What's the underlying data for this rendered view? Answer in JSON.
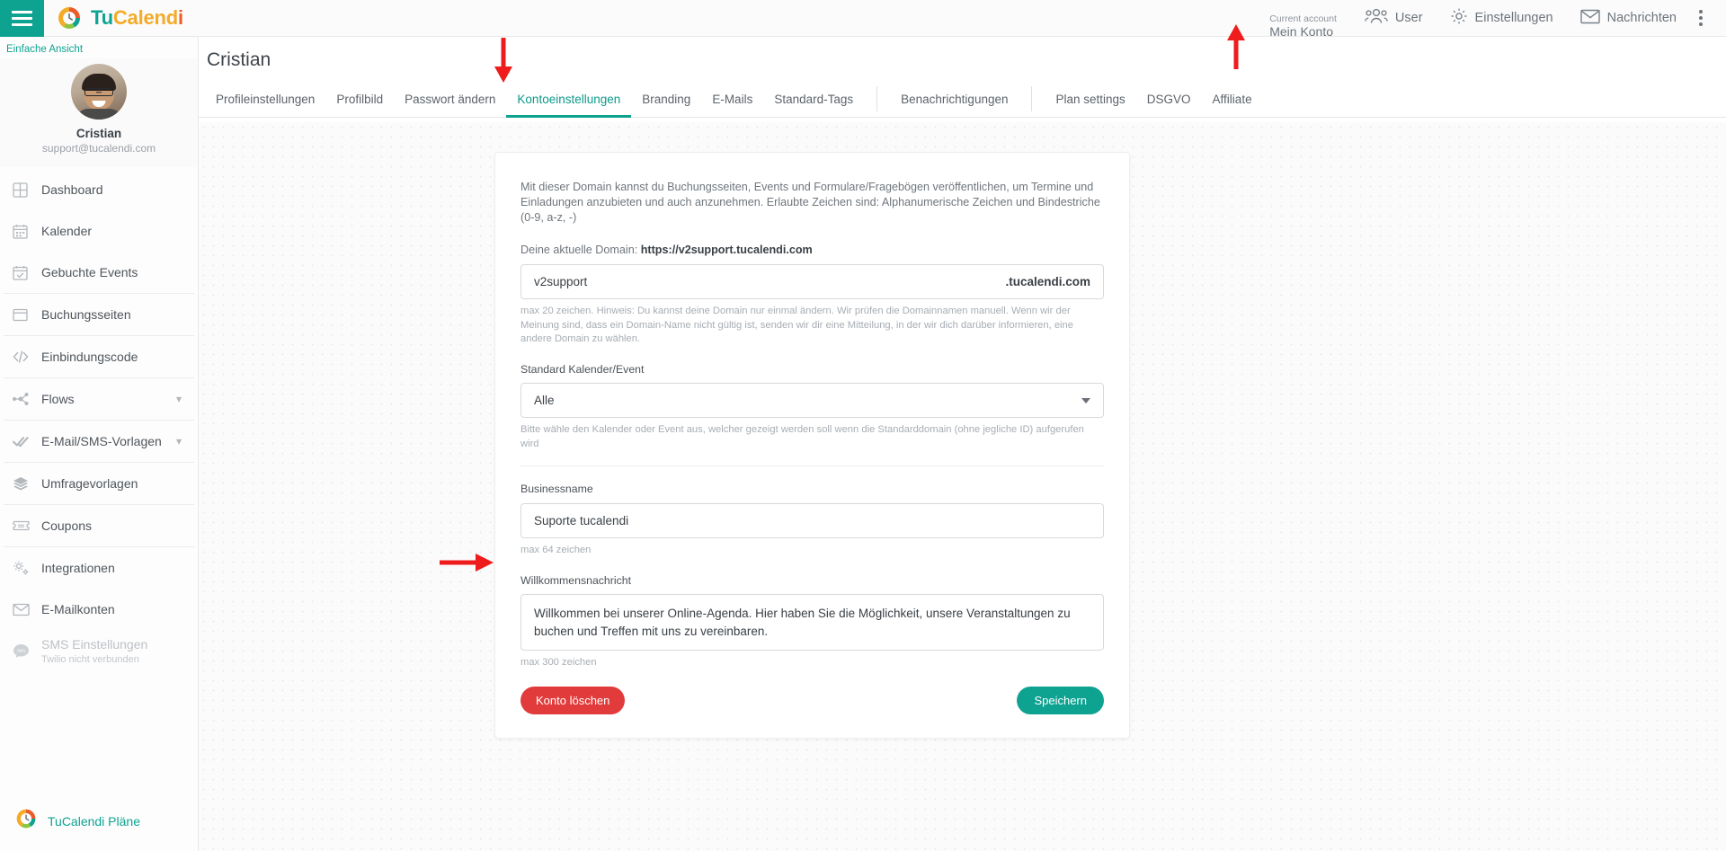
{
  "topbar": {
    "menu_icon": "hamburger-icon",
    "brand": {
      "part1": "Tu",
      "part2": "Calend",
      "part3": "i"
    },
    "account_label": "Current account",
    "account_value": "Mein Konto",
    "items": [
      {
        "label": "User",
        "icon": "users-icon"
      },
      {
        "label": "Einstellungen",
        "icon": "gear-icon"
      },
      {
        "label": "Nachrichten",
        "icon": "envelope-icon"
      }
    ],
    "overflow_icon": "kebab-menu-icon"
  },
  "sidebar": {
    "simple_view": "Einfache Ansicht",
    "profile": {
      "name": "Cristian",
      "email": "support@tucalendi.com",
      "avatar": "user-avatar"
    },
    "items": [
      {
        "label": "Dashboard",
        "icon": "dashboard-icon",
        "dim": false,
        "chevron": false,
        "sep_after": false
      },
      {
        "label": "Kalender",
        "icon": "calendar-icon",
        "dim": false,
        "chevron": false,
        "sep_after": false
      },
      {
        "label": "Gebuchte Events",
        "icon": "calendar-check-icon",
        "dim": false,
        "chevron": false,
        "sep_after": true
      },
      {
        "label": "Buchungsseiten",
        "icon": "window-icon",
        "dim": false,
        "chevron": false,
        "sep_after": true
      },
      {
        "label": "Einbindungscode",
        "icon": "code-icon",
        "dim": false,
        "chevron": false,
        "sep_after": true
      },
      {
        "label": "Flows",
        "icon": "flow-nodes-icon",
        "dim": false,
        "chevron": true,
        "sep_after": true
      },
      {
        "label": "E-Mail/SMS-Vorlagen",
        "icon": "double-check-icon",
        "dim": false,
        "chevron": true,
        "sep_after": true
      },
      {
        "label": "Umfragevorlagen",
        "icon": "layers-icon",
        "dim": false,
        "chevron": false,
        "sep_after": true
      },
      {
        "label": "Coupons",
        "icon": "ticket-icon",
        "dim": false,
        "chevron": false,
        "sep_after": true
      },
      {
        "label": "Integrationen",
        "icon": "gears-icon",
        "dim": false,
        "chevron": false,
        "sep_after": false
      },
      {
        "label": "E-Mailkonten",
        "icon": "envelope-icon",
        "dim": false,
        "chevron": false,
        "sep_after": false
      },
      {
        "label": "SMS Einstellungen",
        "sublabel": "Twilio nicht verbunden",
        "icon": "sms-bubble-icon",
        "dim": true,
        "chevron": false,
        "sep_after": false
      }
    ],
    "plans": {
      "label": "TuCalendi Pläne",
      "icon": "tucalendi-logo-icon"
    }
  },
  "main": {
    "page_title": "Cristian",
    "tabs": [
      {
        "label": "Profileinstellungen",
        "active": false,
        "divider_after": false
      },
      {
        "label": "Profilbild",
        "active": false,
        "divider_after": false
      },
      {
        "label": "Passwort ändern",
        "active": false,
        "divider_after": false
      },
      {
        "label": "Kontoeinstellungen",
        "active": true,
        "divider_after": false
      },
      {
        "label": "Branding",
        "active": false,
        "divider_after": false
      },
      {
        "label": "E-Mails",
        "active": false,
        "divider_after": false
      },
      {
        "label": "Standard-Tags",
        "active": false,
        "divider_after": true
      },
      {
        "label": "Benachrichtigungen",
        "active": false,
        "divider_after": true
      },
      {
        "label": "Plan settings",
        "active": false,
        "divider_after": false
      },
      {
        "label": "DSGVO",
        "active": false,
        "divider_after": false
      },
      {
        "label": "Affiliate",
        "active": false,
        "divider_after": false
      }
    ],
    "card": {
      "description": "Mit dieser Domain kannst du Buchungsseiten, Events und Formulare/Fragebögen veröffentlichen, um Termine und Einladungen anzubieten und auch anzunehmen. Erlaubte Zeichen sind: Alphanumerische Zeichen und Bindestriche (0-9, a-z, -)",
      "current_domain_label": "Deine aktuelle Domain:",
      "current_domain_value": "https://v2support.tucalendi.com",
      "domain_input_value": "v2support",
      "domain_suffix": ".tucalendi.com",
      "domain_hint": "max 20 zeichen. Hinweis: Du kannst deine Domain nur einmal ändern. Wir prüfen die Domainnamen manuell. Wenn wir der Meinung sind, dass ein Domain-Name nicht gültig ist, senden wir dir eine Mitteilung, in der wir dich darüber informieren, eine andere Domain zu wählen.",
      "calendar_label": "Standard Kalender/Event",
      "calendar_value": "Alle",
      "calendar_hint": "Bitte wähle den Kalender oder Event aus, welcher gezeigt werden soll wenn die Standarddomain (ohne jegliche ID) aufgerufen wird",
      "business_label": "Businessname",
      "business_value": "Suporte tucalendi",
      "business_hint": "max 64 zeichen",
      "welcome_label": "Willkommensnachricht",
      "welcome_value": "Willkommen bei unserer Online-Agenda. Hier haben Sie die Möglichkeit, unsere Veranstaltungen zu buchen und Treffen mit uns zu vereinbaren.",
      "welcome_hint": "max 300 zeichen",
      "delete_button": "Konto löschen",
      "save_button": "Speichern"
    }
  },
  "colors": {
    "brand_teal": "#0ea391",
    "brand_yellow": "#f4ab28",
    "brand_orange": "#ea5b2a",
    "danger_red": "#e23b3b",
    "annotation_red": "#ee1c1c"
  }
}
